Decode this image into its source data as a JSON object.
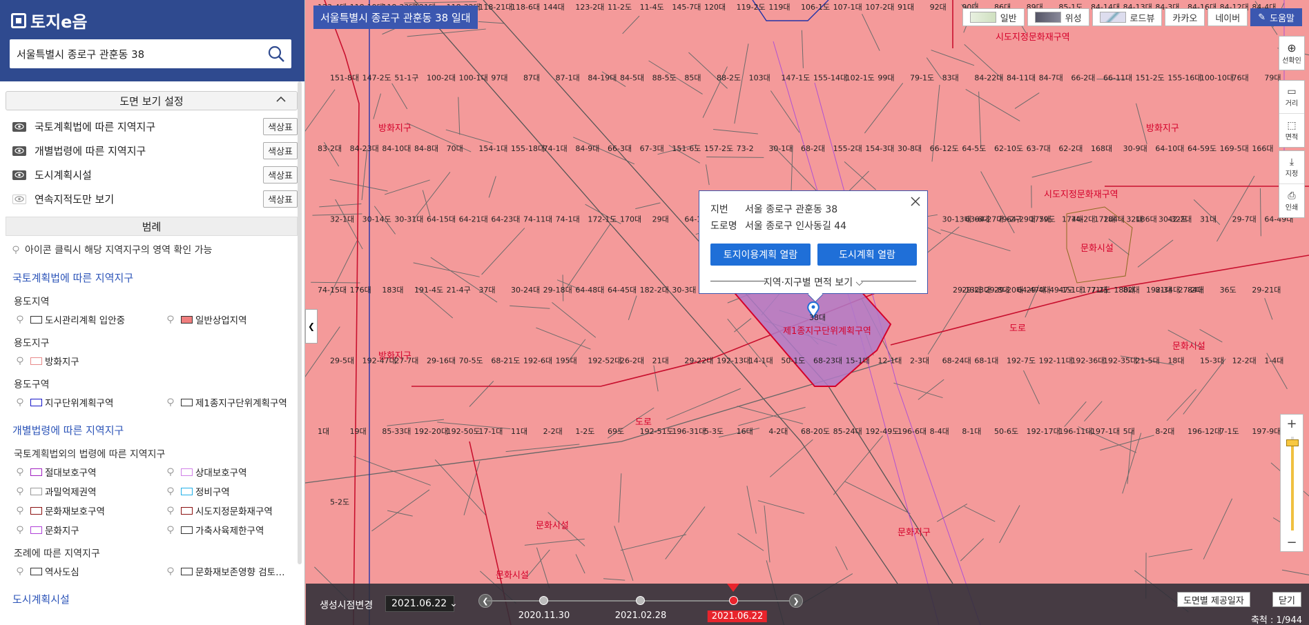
{
  "app": {
    "logo_text": "토지e음",
    "search_value": "서울특별시 종로구 관훈동 38"
  },
  "sidebar": {
    "view_settings_title": "도면 보기 설정",
    "layers": [
      {
        "label": "국토계획법에 따른 지역지구",
        "visible": true,
        "button": "색상표"
      },
      {
        "label": "개별법령에 따른 지역지구",
        "visible": true,
        "button": "색상표"
      },
      {
        "label": "도시계획시설",
        "visible": true,
        "button": "색상표"
      },
      {
        "label": "연속지적도만 보기",
        "visible": false,
        "button": "색상표"
      }
    ],
    "legend_title": "범례",
    "legend_note": "아이콘 클릭시 해당 지역지구의 영역 확인 가능",
    "sections": [
      {
        "title": "국토계획법에 따른 지역지구",
        "groups": [
          {
            "subtitle": "용도지역",
            "items": [
              {
                "label": "도시관리계획 입안중",
                "color": "#ffffff",
                "border": "#333333"
              },
              {
                "label": "일반상업지역",
                "color": "#f07e7e",
                "border": "#333333"
              }
            ]
          },
          {
            "subtitle": "용도지구",
            "items": [
              {
                "label": "방화지구",
                "color": "#ffffff",
                "border": "#e88a8a"
              }
            ]
          },
          {
            "subtitle": "용도구역",
            "items": [
              {
                "label": "지구단위계획구역",
                "color": "#ffffff",
                "border": "#1515c8"
              },
              {
                "label": "제1종지구단위계획구역",
                "color": "#ffffff",
                "border": "#333333"
              }
            ]
          }
        ]
      },
      {
        "title": "개별법령에 따른 지역지구",
        "groups": [
          {
            "subtitle": "국토계획법외의 법령에 따른 지역지구",
            "items": [
              {
                "label": "절대보호구역",
                "color": "#ffffff",
                "border": "#a020c0"
              },
              {
                "label": "상대보호구역",
                "color": "#ffffff",
                "border": "#d080e8"
              },
              {
                "label": "과밀억제권역",
                "color": "#ffffff",
                "border": "#999999"
              },
              {
                "label": "정비구역",
                "color": "#ffffff",
                "border": "#20b0e8"
              },
              {
                "label": "문화재보호구역",
                "color": "#ffffff",
                "border": "#8a1010"
              },
              {
                "label": "시도지정문화재구역",
                "color": "#ffffff",
                "border": "#8a1010"
              },
              {
                "label": "문화지구",
                "color": "#ffffff",
                "border": "#b040d8"
              },
              {
                "label": "가축사육제한구역",
                "color": "#ffffff",
                "border": "#333333"
              }
            ]
          },
          {
            "subtitle": "조례에 따른 지역지구",
            "items": [
              {
                "label": "역사도심",
                "color": "#ffffff",
                "border": "#333333"
              },
              {
                "label": "문화재보존영향 검토…",
                "color": "#ffffff",
                "border": "#333333"
              }
            ]
          }
        ]
      },
      {
        "title": "도시계획시설",
        "groups": []
      }
    ]
  },
  "map": {
    "title": "서울특별시 종로구 관훈동 38 일대",
    "map_types": [
      "일반",
      "위성",
      "로드뷰",
      "카카오",
      "네이버"
    ],
    "help_label": "도움말",
    "tools_top": [
      {
        "label": "선확인",
        "icon": "plus-circle-icon"
      }
    ],
    "tools_measure": [
      {
        "label": "거리",
        "icon": "ruler-icon"
      },
      {
        "label": "면적",
        "icon": "area-icon"
      }
    ],
    "tools_io": [
      {
        "label": "지정",
        "icon": "download-icon"
      },
      {
        "label": "인쇄",
        "icon": "print-icon"
      }
    ],
    "zoom_in": "+",
    "zoom_out": "−",
    "parcels": [
      "123-4대",
      "118-19대",
      "118-33대",
      "121대",
      "118-32대",
      "118-21대",
      "118-6대",
      "144대",
      "123-2대",
      "11-2도",
      "11-4도",
      "145-7대",
      "120대",
      "119-2도",
      "119대",
      "106-1도",
      "107-1대",
      "107-2대",
      "91대",
      "92대",
      "90대",
      "86대",
      "89대",
      "85-1도",
      "84-14대",
      "84-13대",
      "84-3대",
      "84-16대",
      "84-12대",
      "84-4대",
      "151-8대",
      "147-2도",
      "51-1구",
      "100-2대",
      "100-1대",
      "97대",
      "87대",
      "87-1대",
      "84-19대",
      "84-5대",
      "88-5도",
      "85대",
      "88-2도",
      "103대",
      "147-1도",
      "155-14대",
      "102-1도",
      "99대",
      "79-1도",
      "83대",
      "84-22대",
      "84-11대",
      "84-7대",
      "66-2대",
      "66-11대",
      "151-2도",
      "155-16대",
      "100-10대",
      "76대",
      "79대",
      "83-2대",
      "84-23대",
      "84-10대",
      "84-8대",
      "70대",
      "154-1대",
      "155-18대",
      "74-1대",
      "84-9대",
      "66-3대",
      "67-3대",
      "151-6도",
      "157-2도",
      "73-2",
      "30-1대",
      "68-2대",
      "155-2대",
      "154-3대",
      "30-8대",
      "66-12도",
      "64-5도",
      "62-10도",
      "63-7대",
      "62-2대",
      "168대",
      "30-9대",
      "64-10대",
      "64-59도",
      "169-5대",
      "166대",
      "32-1대",
      "30-14도",
      "30-31대",
      "64-15대",
      "64-21대",
      "64-23대",
      "74-11대",
      "74-1대",
      "172-1도",
      "170대",
      "29대",
      "64-19대",
      "63-6대",
      "79-2구",
      "175대",
      "174대",
      "172대",
      "32대",
      "30-32도",
      "30-13대",
      "64-27대",
      "64-29대",
      "79도",
      "74-2대",
      "184대",
      "186대",
      "42-2대",
      "31대",
      "29-7대",
      "64-49대",
      "74-15대",
      "176대",
      "183대",
      "191-4도",
      "21-4구",
      "37대",
      "30-24대",
      "29-18대",
      "64-48대",
      "64-45대",
      "182-2대",
      "30-3대",
      "29-13대",
      "29-8대",
      "64-47대",
      "49-1도",
      "177-2도",
      "180대",
      "192-34대",
      "27-2대",
      "29-23대",
      "29-20대",
      "29-4대",
      "47-1대",
      "71대",
      "82대",
      "81대",
      "84대",
      "36도",
      "29-21대",
      "29-5대",
      "192-47대",
      "27-7대",
      "29-16대",
      "70-5도",
      "68-21도",
      "192-6대",
      "195대",
      "192-52대",
      "26-2대",
      "21대",
      "29-22대",
      "192-13대",
      "14-1대",
      "50-1도",
      "68-23대",
      "15-1대",
      "12-1대",
      "2-3대",
      "68-24대",
      "68-1대",
      "192-7도",
      "192-11대",
      "192-36대",
      "192-35대",
      "21-5대",
      "18대",
      "15-3대",
      "12-2대",
      "1-4대",
      "1대",
      "19대",
      "85-33대",
      "192-20대",
      "192-50도",
      "17-1대",
      "11대",
      "2-2대",
      "1-2도",
      "69도",
      "192-51도",
      "196-31대",
      "5-3도",
      "16대",
      "4-2대",
      "68-20도",
      "85-24대",
      "192-49도",
      "196-6대",
      "8-4대",
      "8-1대",
      "50-6도",
      "192-17대",
      "196-11대",
      "197-1대",
      "5대",
      "8-2대",
      "196-12대",
      "7-1도",
      "197-9대",
      "5-2도"
    ],
    "zone_labels": [
      "방화지구",
      "방화지구",
      "방화지구",
      "도로",
      "도로",
      "문화지구",
      "문화시설",
      "문화시설",
      "문화시설",
      "문화시설",
      "시도지정문화재구역",
      "시도지정문화재구역",
      "제1종지구단위계획구역"
    ],
    "popup": {
      "jibun_key": "지번",
      "jibun_value": "서울 종로구 관훈동 38",
      "road_key": "도로명",
      "road_value": "서울 종로구 인사동길 44",
      "btn_land": "토지이용계획 열람",
      "btn_city": "도시계획 열람",
      "more": "지역·지구별 면적 보기"
    },
    "marker_label": "38대"
  },
  "timeline": {
    "label": "생성시점변경",
    "selected": "2021.06.22",
    "dates": [
      "2020.11.30",
      "2021.02.28",
      "2021.06.22"
    ],
    "active_index": 2,
    "btn_date": "도면별 제공일자",
    "btn_close": "닫기",
    "scale": "축척 : 1/944"
  },
  "colors": {
    "header": "#2f4a8f",
    "map_fill": "#f49a9a",
    "selected_parcel": "#b07ac8",
    "accent_blue": "#1f6fd8",
    "active_red": "#e8242c"
  }
}
